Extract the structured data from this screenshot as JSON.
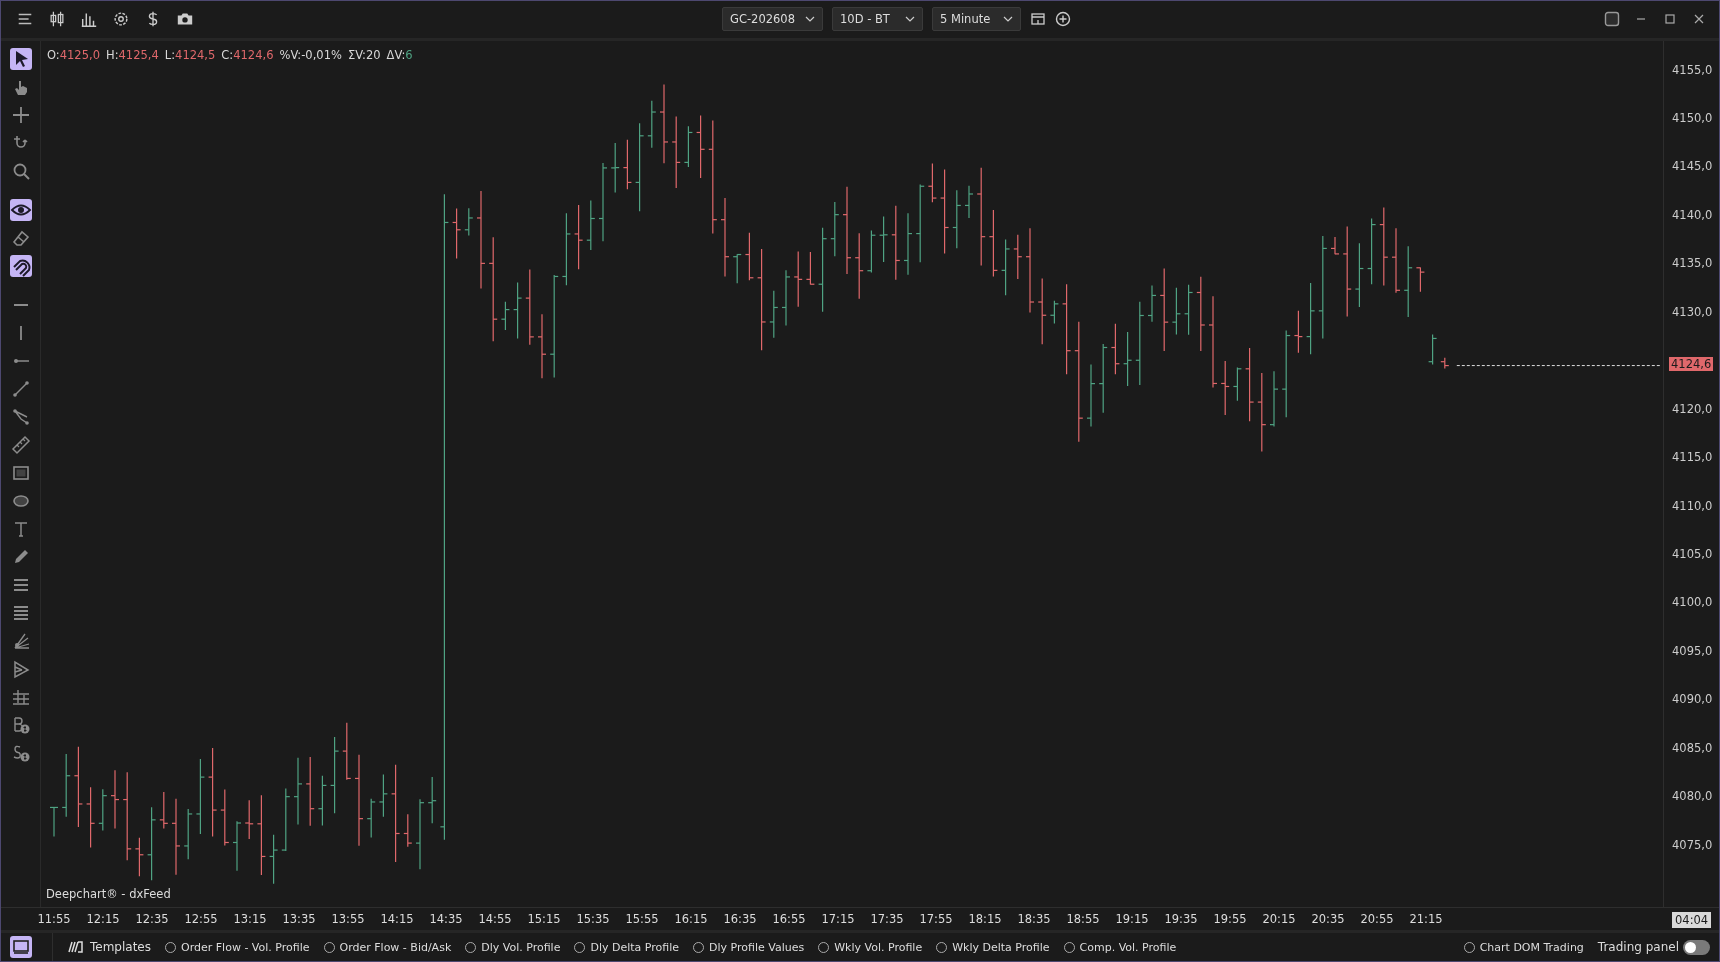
{
  "toolbar": {
    "instrument": "GC-202608",
    "range": "10D - BT",
    "interval": "5 Minute"
  },
  "tool_groups": [
    [
      {
        "kind": "cursor",
        "selected": true
      },
      {
        "kind": "hand",
        "selected": false
      },
      {
        "kind": "crosshair",
        "selected": false
      },
      {
        "kind": "hook",
        "selected": false
      },
      {
        "kind": "zoom",
        "selected": false
      }
    ],
    [
      {
        "kind": "eye",
        "selected": true
      },
      {
        "kind": "eraser",
        "selected": false
      },
      {
        "kind": "magnet",
        "selected": true
      }
    ],
    [
      {
        "kind": "hline",
        "selected": false
      },
      {
        "kind": "vline",
        "selected": false
      },
      {
        "kind": "ray",
        "selected": false
      },
      {
        "kind": "segment",
        "selected": false
      },
      {
        "kind": "polyline",
        "selected": false
      },
      {
        "kind": "ruler",
        "selected": false
      },
      {
        "kind": "rectangle",
        "selected": false
      },
      {
        "kind": "ellipse",
        "selected": false
      },
      {
        "kind": "text",
        "selected": false
      },
      {
        "kind": "pencil",
        "selected": false
      },
      {
        "kind": "lines3",
        "selected": false
      },
      {
        "kind": "lines4",
        "selected": false
      },
      {
        "kind": "fan",
        "selected": false
      },
      {
        "kind": "wedge",
        "selected": false
      },
      {
        "kind": "levels",
        "selected": false
      },
      {
        "kind": "bdollar",
        "selected": false
      },
      {
        "kind": "sdollar",
        "selected": false
      }
    ]
  ],
  "ohlc": [
    {
      "label": "O:",
      "value": "4125,0",
      "color": "#e0686b"
    },
    {
      "label": "H:",
      "value": "4125,4",
      "color": "#e0686b"
    },
    {
      "label": "L:",
      "value": "4124,5",
      "color": "#e0686b"
    },
    {
      "label": "C:",
      "value": "4124,6",
      "color": "#e0686b"
    },
    {
      "label": "%V:",
      "value": "-0,01%",
      "color": "#d8d8d8"
    },
    {
      "label": "ΣV:",
      "value": "20",
      "color": "#d8d8d8"
    },
    {
      "label": "ΔV:",
      "value": "6",
      "color": "#4fa383"
    }
  ],
  "price_axis": [
    "4155,0",
    "4150,0",
    "4145,0",
    "4140,0",
    "4135,0",
    "4130,0",
    "4120,0",
    "4115,0",
    "4110,0",
    "4105,0",
    "4100,0",
    "4095,0",
    "4090,0",
    "4085,0",
    "4080,0",
    "4075,0"
  ],
  "last_price": "4124,6",
  "time_axis": [
    "11:55",
    "12:15",
    "12:35",
    "12:55",
    "13:15",
    "13:35",
    "13:55",
    "14:15",
    "14:35",
    "14:55",
    "15:15",
    "15:35",
    "15:55",
    "16:15",
    "16:35",
    "16:55",
    "17:15",
    "17:35",
    "17:55",
    "18:15",
    "18:35",
    "18:55",
    "19:15",
    "19:35",
    "19:55",
    "20:15",
    "20:35",
    "20:55",
    "21:15"
  ],
  "countdown": "04:04",
  "source_label": "Deepchart® - dxFeed",
  "templates_label": "Templates",
  "templates": [
    {
      "label": "Order Flow - Vol. Profile",
      "selected": false
    },
    {
      "label": "Order Flow - Bid/Ask",
      "selected": false
    },
    {
      "label": "Dly Vol. Profile",
      "selected": false
    },
    {
      "label": "Dly Delta Profile",
      "selected": false
    },
    {
      "label": "Dly Profile Values",
      "selected": false
    },
    {
      "label": "Wkly Vol. Profile",
      "selected": false
    },
    {
      "label": "Wkly Delta Profile",
      "selected": false
    },
    {
      "label": "Comp. Vol. Profile",
      "selected": false
    }
  ],
  "chart_dom_trading": {
    "label": "Chart DOM Trading",
    "selected": false
  },
  "trading_panel": {
    "label": "Trading panel",
    "on": false
  }
}
